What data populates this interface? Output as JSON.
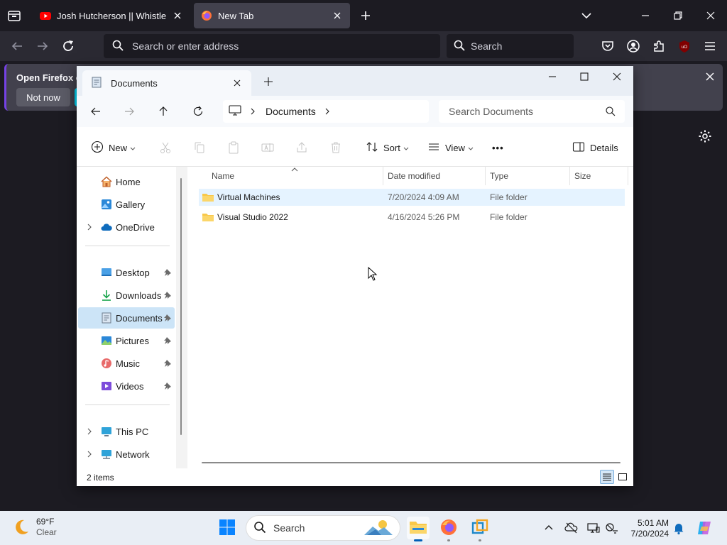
{
  "browser": {
    "tabs": [
      {
        "title": "Josh Hutcherson || Whistle - Yo",
        "active": false
      },
      {
        "title": "New Tab",
        "active": true
      }
    ],
    "url_placeholder": "Search or enter address",
    "search_placeholder": "Search",
    "notification": {
      "title": "Open Firefox ev",
      "dismiss_label": "Not now"
    }
  },
  "explorer": {
    "tab_title": "Documents",
    "breadcrumb": [
      "Documents"
    ],
    "search_placeholder": "Search Documents",
    "commands": {
      "new": "New",
      "sort": "Sort",
      "view": "View",
      "more": "•••",
      "details": "Details"
    },
    "nav": {
      "home": "Home",
      "gallery": "Gallery",
      "onedrive": "OneDrive",
      "desktop": "Desktop",
      "downloads": "Downloads",
      "documents": "Documents",
      "pictures": "Pictures",
      "music": "Music",
      "videos": "Videos",
      "thispc": "This PC",
      "network": "Network"
    },
    "columns": [
      "Name",
      "Date modified",
      "Type",
      "Size"
    ],
    "files": [
      {
        "name": "Virtual Machines",
        "date": "7/20/2024 4:09 AM",
        "type": "File folder",
        "size": ""
      },
      {
        "name": "Visual Studio 2022",
        "date": "4/16/2024 5:26 PM",
        "type": "File folder",
        "size": ""
      }
    ],
    "status_count": "2 items"
  },
  "taskbar": {
    "weather_temp": "69°F",
    "weather_cond": "Clear",
    "search_placeholder": "Search",
    "time": "5:01 AM",
    "date": "7/20/2024"
  },
  "colors": {
    "accent": "#005fb8",
    "selection": "#cce4f7",
    "folder": "#f8c84a",
    "firefox_bg": "#1c1b22"
  }
}
